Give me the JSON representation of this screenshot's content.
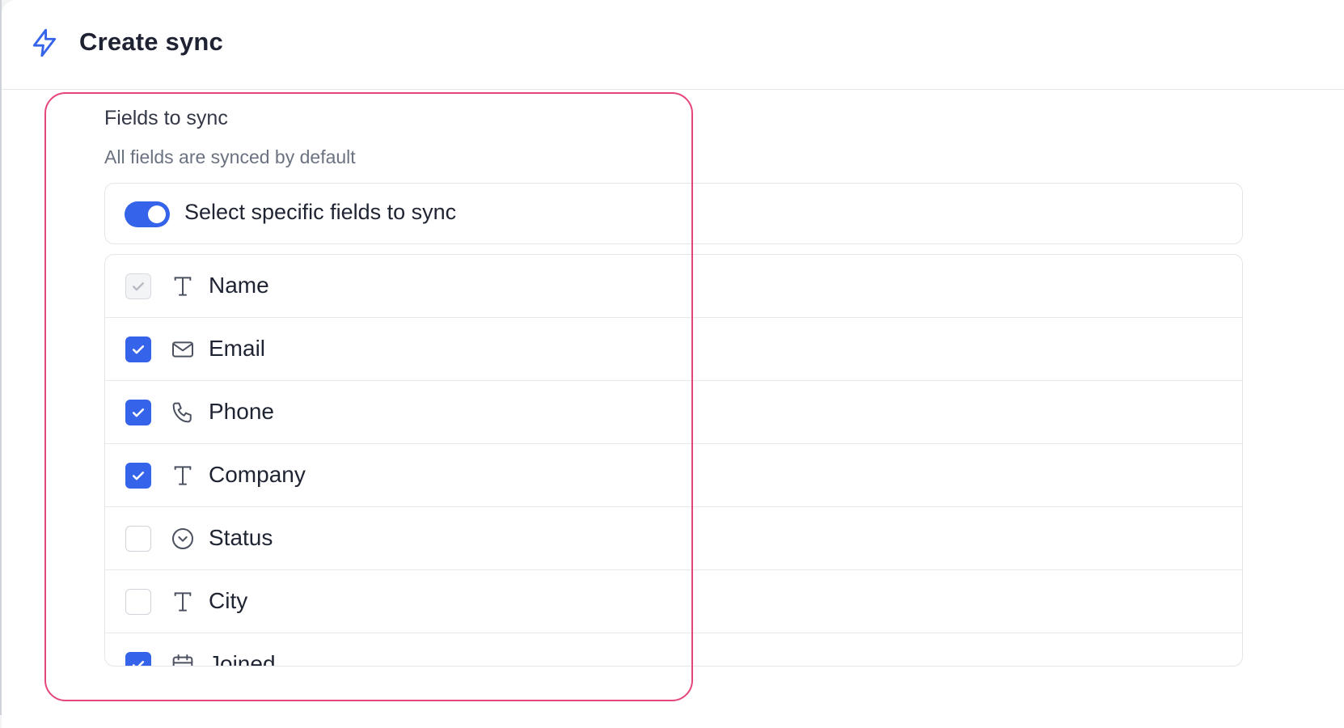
{
  "header": {
    "title": "Create sync",
    "icon": "lightning-bolt-icon",
    "accent_color": "#3563e9"
  },
  "fields_section": {
    "label": "Fields to sync",
    "hint": "All fields are synced by default",
    "highlight_color": "#e6457a"
  },
  "toggle": {
    "label": "Select specific fields to sync",
    "enabled": true
  },
  "fields": [
    {
      "label": "Name",
      "icon": "text-type-icon",
      "checked": true,
      "disabled": true
    },
    {
      "label": "Email",
      "icon": "mail-icon",
      "checked": true,
      "disabled": false
    },
    {
      "label": "Phone",
      "icon": "phone-icon",
      "checked": true,
      "disabled": false
    },
    {
      "label": "Company",
      "icon": "text-type-icon",
      "checked": true,
      "disabled": false
    },
    {
      "label": "Status",
      "icon": "chevron-circle-icon",
      "checked": false,
      "disabled": false
    },
    {
      "label": "City",
      "icon": "text-type-icon",
      "checked": false,
      "disabled": false
    },
    {
      "label": "Joined",
      "icon": "calendar-icon",
      "checked": true,
      "disabled": false
    }
  ]
}
